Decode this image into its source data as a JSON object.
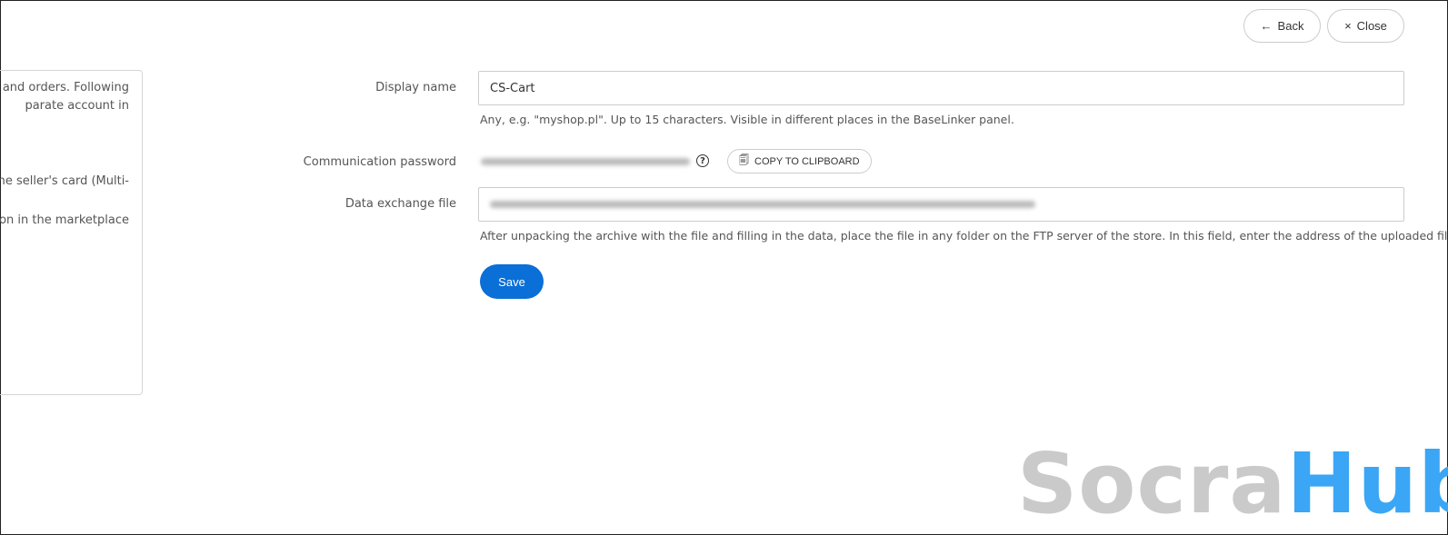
{
  "header": {
    "back_label": "Back",
    "close_label": "Close",
    "back_icon": "arrow-left",
    "close_icon": "×"
  },
  "left_panel": {
    "lines": [
      "ts and orders. Following",
      "parate account in",
      "he seller's card (Multi-",
      "tion in the marketplace"
    ]
  },
  "form": {
    "display_name": {
      "label": "Display name",
      "value": "CS-Cart",
      "help": "Any, e.g. \"myshop.pl\". Up to 15 characters. Visible in different places in the BaseLinker panel."
    },
    "communication_password": {
      "label": "Communication password",
      "copy_label": "COPY TO CLIPBOARD",
      "help_icon": "?"
    },
    "data_exchange_file": {
      "label": "Data exchange file",
      "help": "After unpacking the archive with the file and filling in the data, place the file in any folder on the FTP server of the store. In this field, enter the address of the uploaded file."
    },
    "save_label": "Save"
  },
  "watermark": {
    "part1": "Socra",
    "part2": "Hub"
  }
}
